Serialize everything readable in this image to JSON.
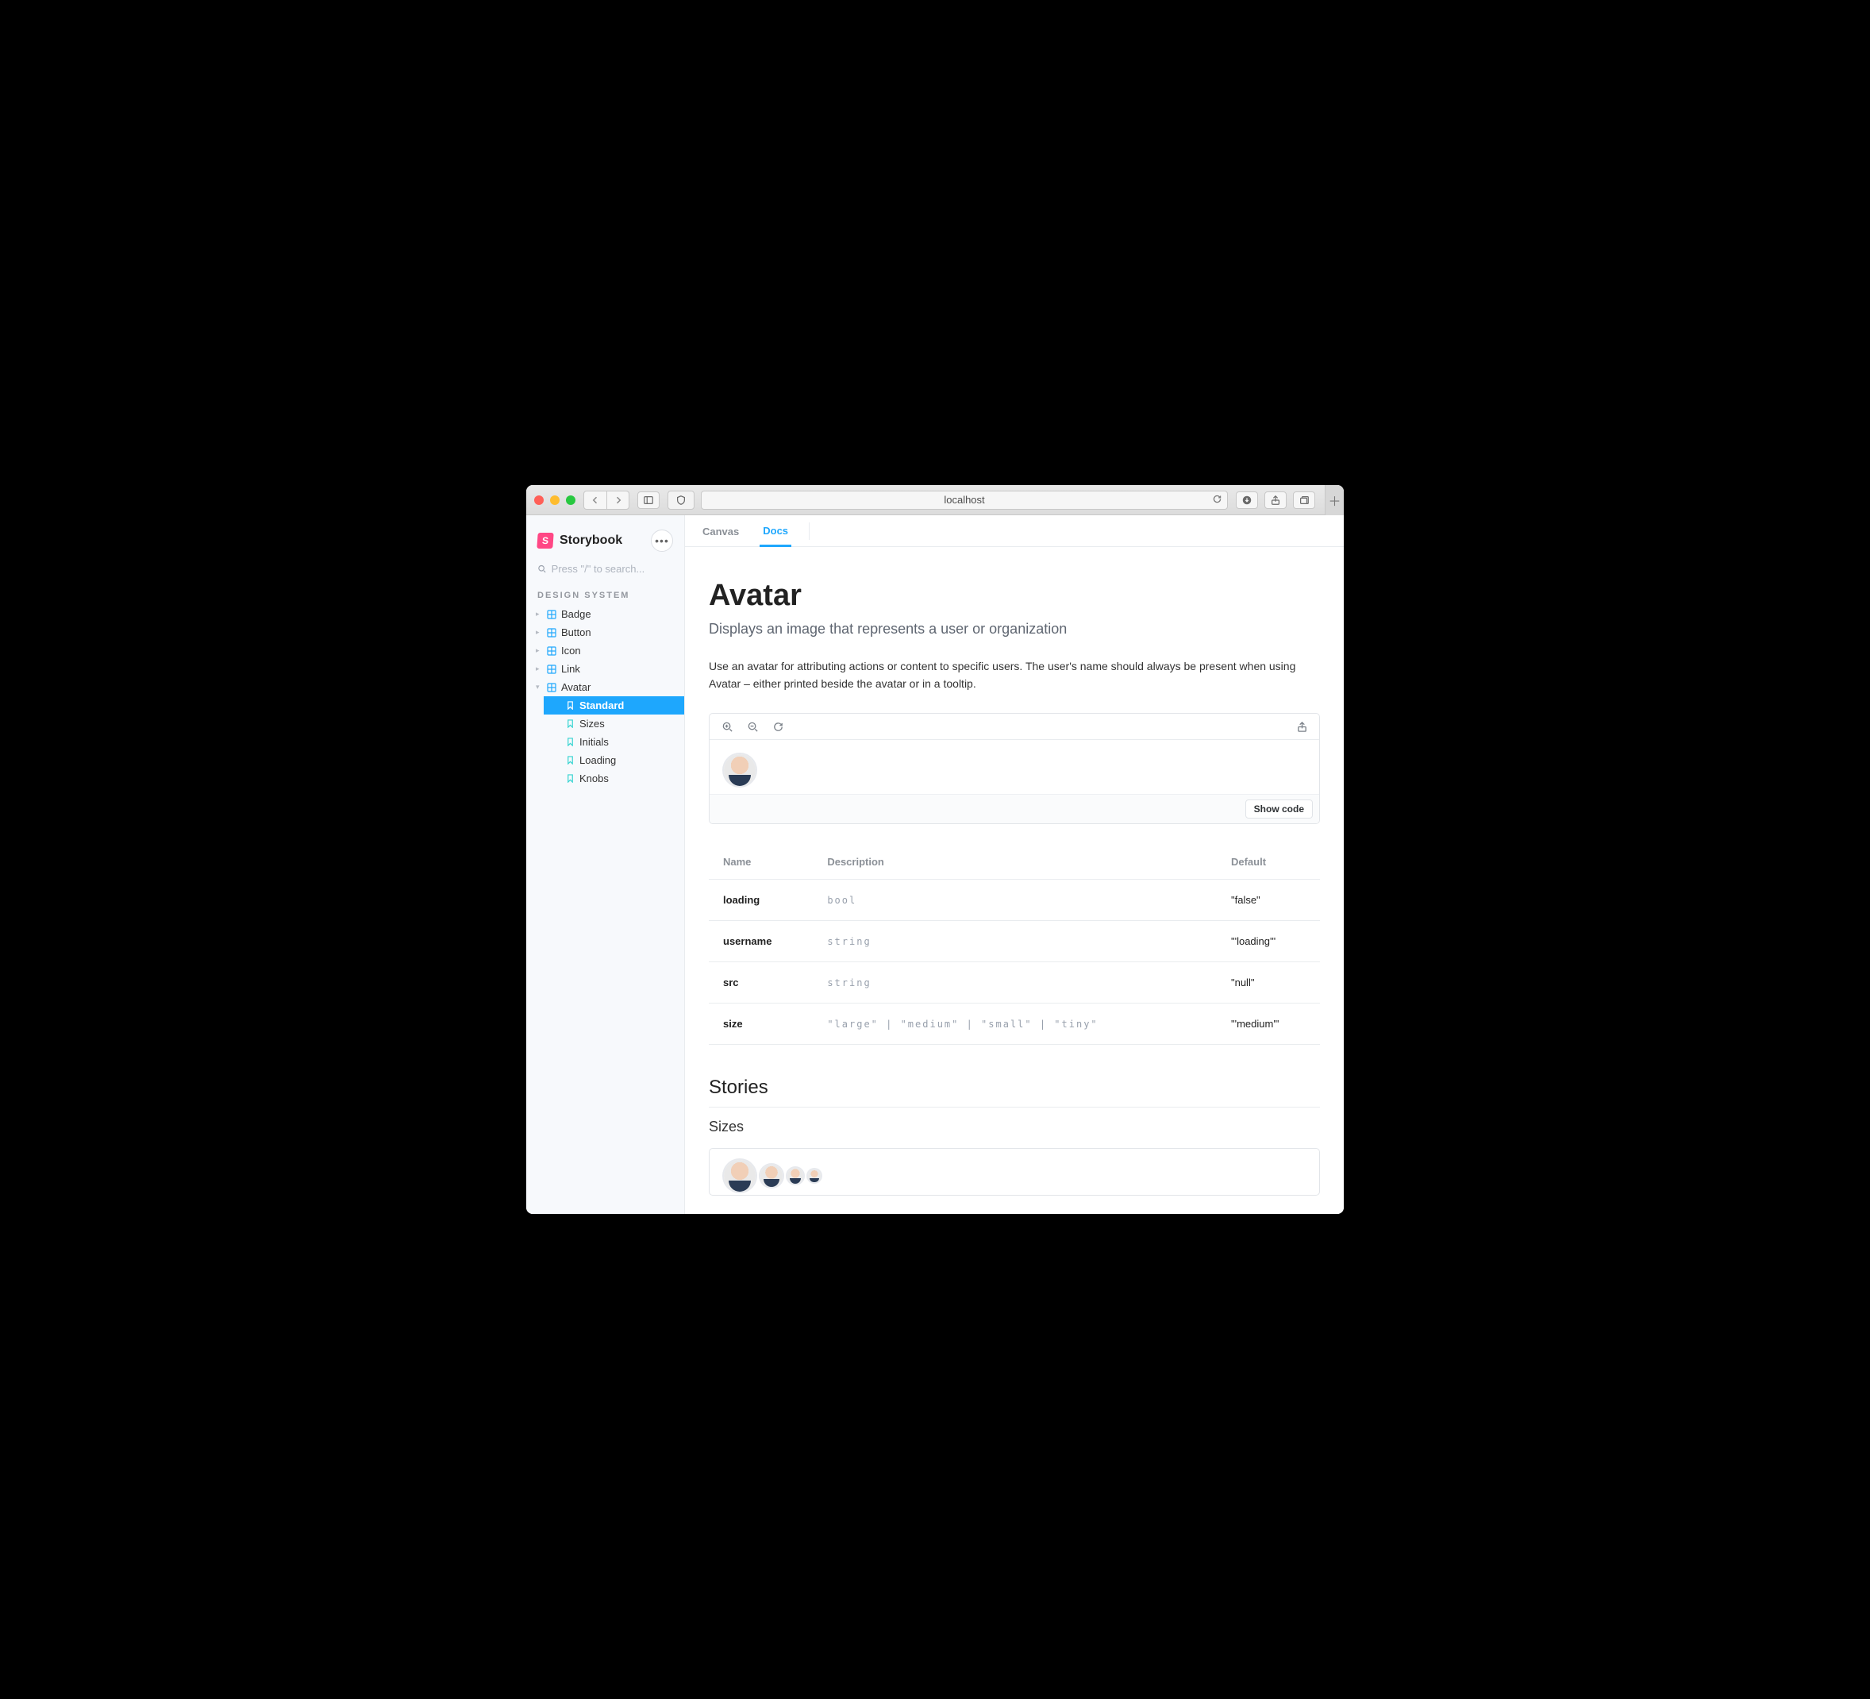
{
  "browser": {
    "address": "localhost"
  },
  "brand": {
    "logo_letter": "S",
    "name": "Storybook"
  },
  "search": {
    "placeholder": "Press \"/\" to search..."
  },
  "sidebar": {
    "group": "DESIGN SYSTEM",
    "items": [
      {
        "label": "Badge",
        "expanded": false,
        "kind": "component"
      },
      {
        "label": "Button",
        "expanded": false,
        "kind": "component"
      },
      {
        "label": "Icon",
        "expanded": false,
        "kind": "component"
      },
      {
        "label": "Link",
        "expanded": false,
        "kind": "component"
      },
      {
        "label": "Avatar",
        "expanded": true,
        "kind": "component",
        "children": [
          {
            "label": "Standard",
            "active": true
          },
          {
            "label": "Sizes"
          },
          {
            "label": "Initials"
          },
          {
            "label": "Loading"
          },
          {
            "label": "Knobs"
          }
        ]
      }
    ]
  },
  "tabs": {
    "canvas": "Canvas",
    "docs": "Docs",
    "active": "docs"
  },
  "doc": {
    "title": "Avatar",
    "subtitle": "Displays an image that represents a user or organization",
    "body": "Use an avatar for attributing actions or content to specific users. The user's name should always be present when using Avatar – either printed beside the avatar or in a tooltip.",
    "show_code": "Show code",
    "props": {
      "headers": {
        "name": "Name",
        "description": "Description",
        "default": "Default"
      },
      "rows": [
        {
          "name": "loading",
          "description": "bool",
          "default": "\"false\""
        },
        {
          "name": "username",
          "description": "string",
          "default": "\"'loading'\""
        },
        {
          "name": "src",
          "description": "string",
          "default": "\"null\""
        },
        {
          "name": "size",
          "description": "\"large\" | \"medium\" | \"small\" | \"tiny\"",
          "default": "\"'medium'\""
        }
      ]
    },
    "stories_heading": "Stories",
    "story_sizes_title": "Sizes"
  }
}
